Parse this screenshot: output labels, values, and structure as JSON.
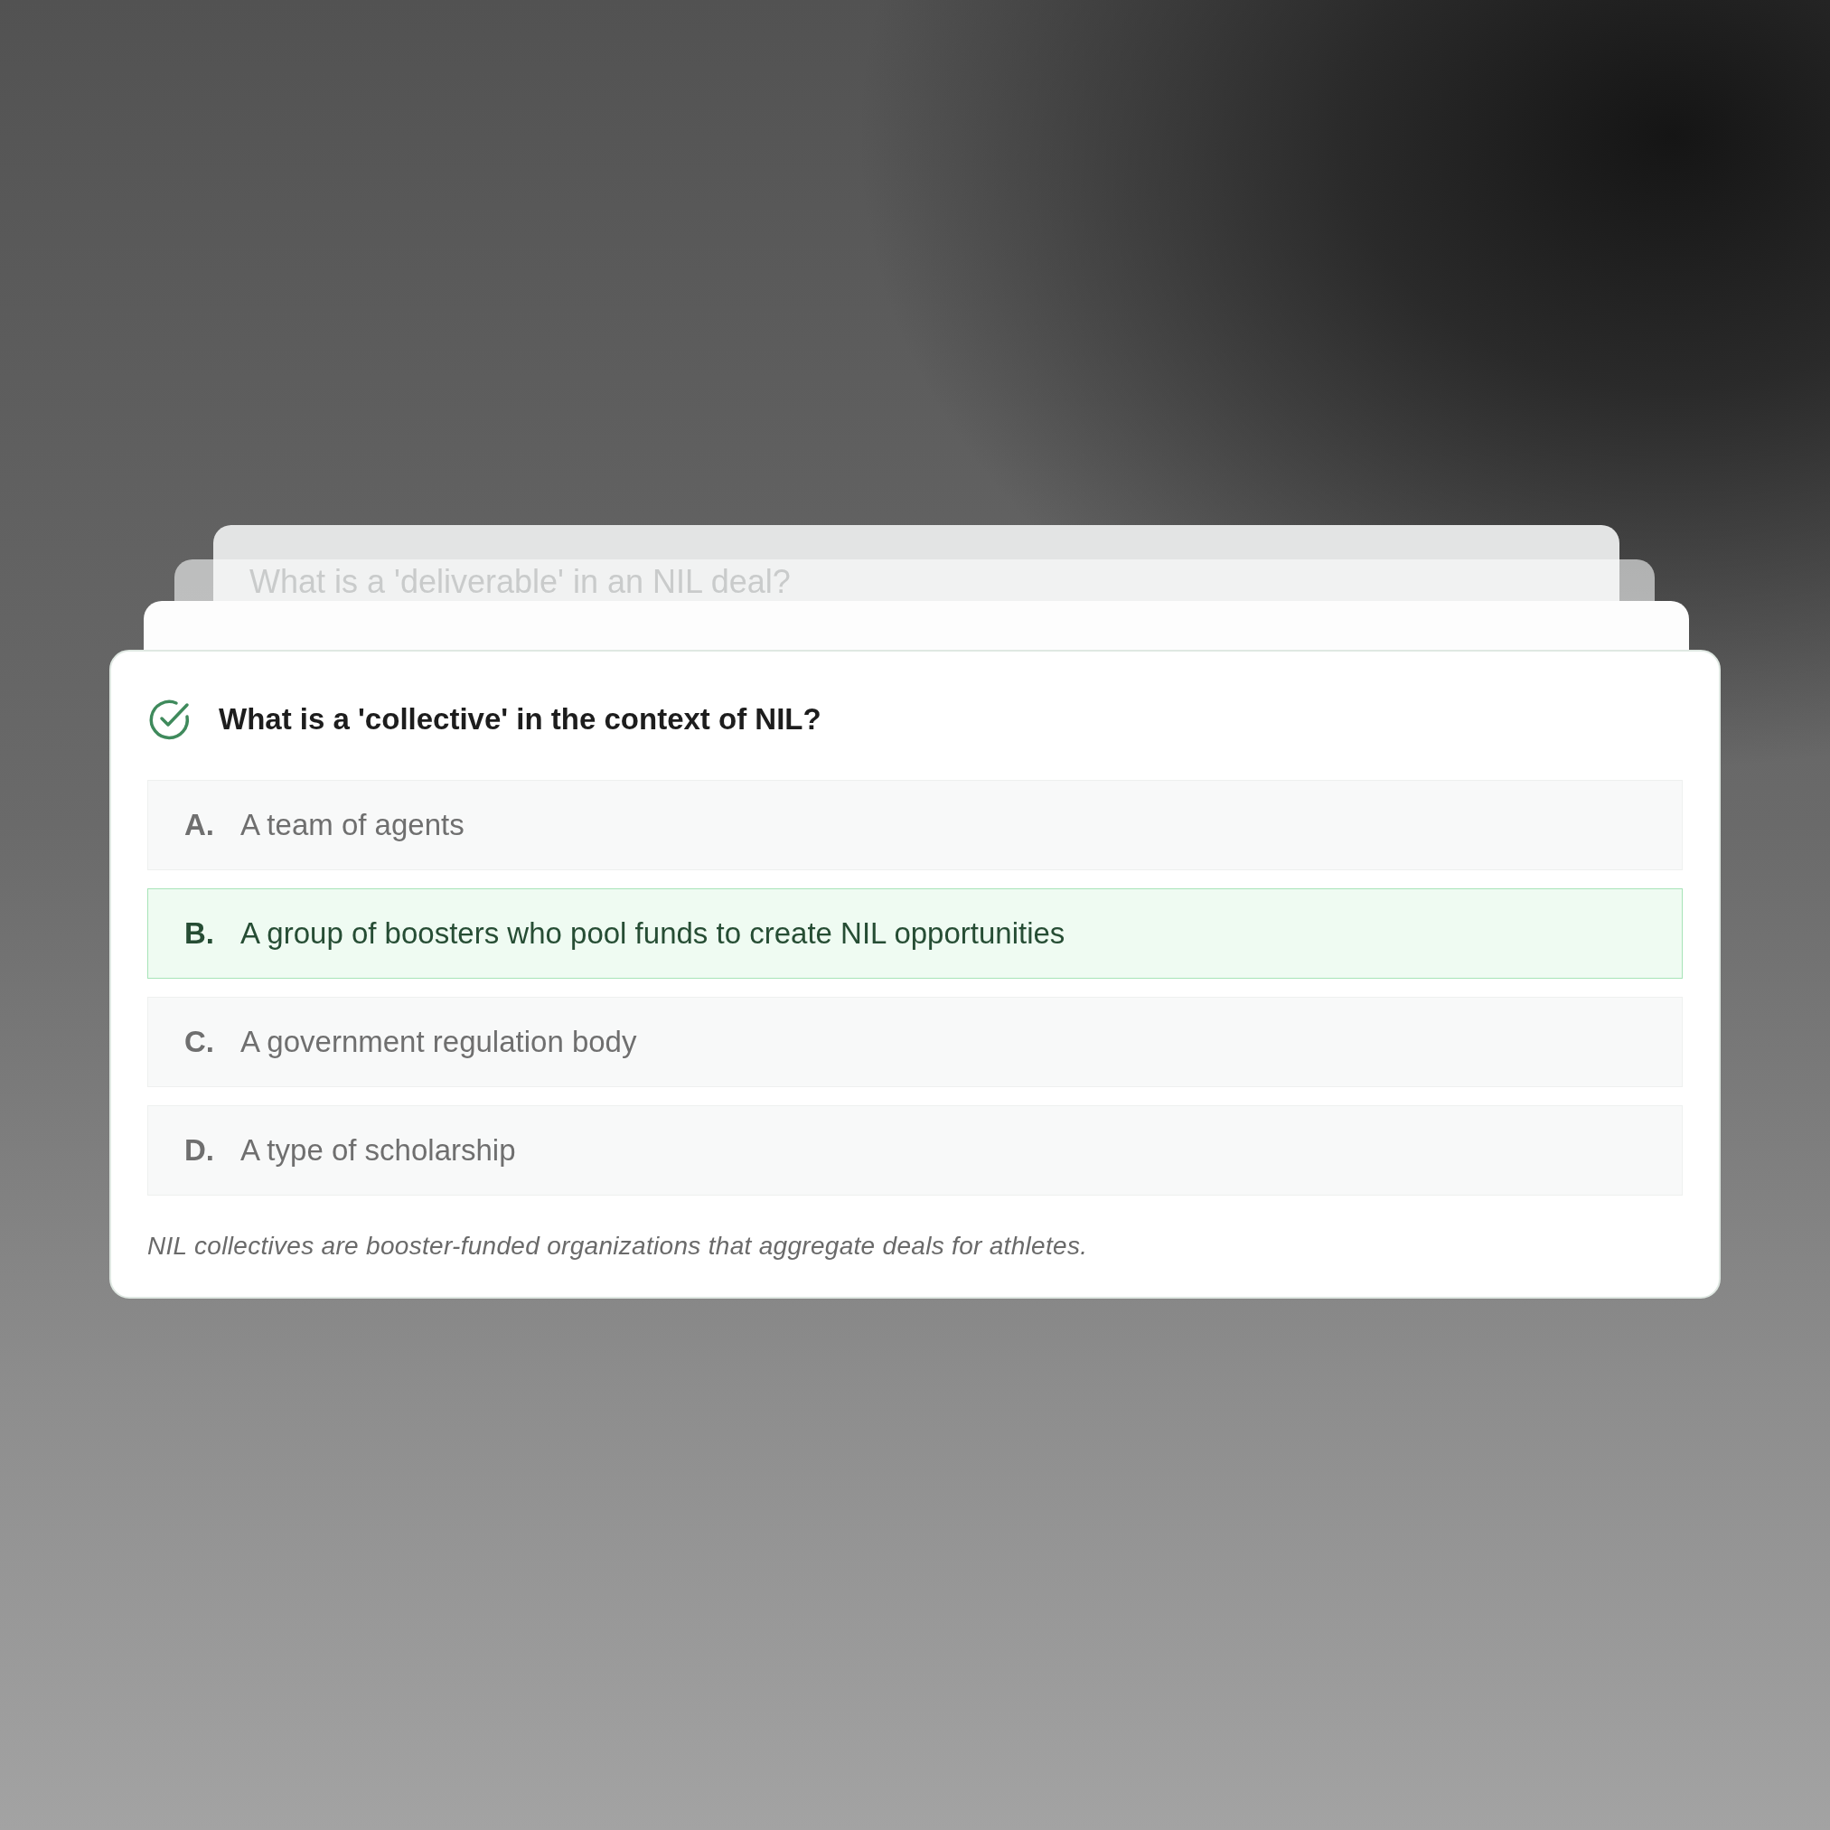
{
  "stack": {
    "back_question": "What is a 'deliverable' in an NIL deal?"
  },
  "question": {
    "text": "What is a 'collective' in the context of NIL?",
    "answered": true
  },
  "options": [
    {
      "letter": "A.",
      "text": "A team of agents",
      "selected": false
    },
    {
      "letter": "B.",
      "text": "A group of boosters who pool funds to create NIL opportunities",
      "selected": true
    },
    {
      "letter": "C.",
      "text": "A government regulation body",
      "selected": false
    },
    {
      "letter": "D.",
      "text": "A type of scholarship",
      "selected": false
    }
  ],
  "explanation": "NIL collectives are booster-funded organizations that aggregate deals for athletes."
}
